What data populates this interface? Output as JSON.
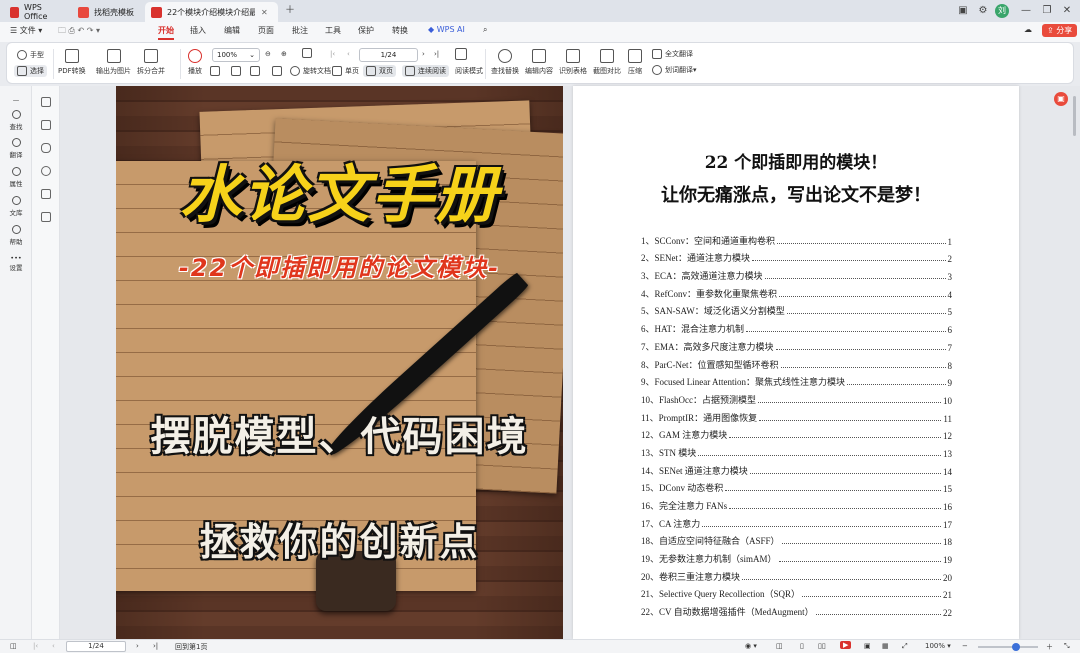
{
  "tabs": [
    {
      "label": "WPS Office",
      "color": "#d9322e"
    },
    {
      "label": "找稻壳模板",
      "color": "#e8483d"
    },
    {
      "label": "22个模块介绍模块介绍最新在...",
      "color": "#d9322e"
    }
  ],
  "menubar": {
    "file": "文件",
    "items": [
      "开始",
      "插入",
      "编辑",
      "页面",
      "批注",
      "工具",
      "保护",
      "转换"
    ],
    "active": "开始",
    "wps_ai": "WPS AI",
    "share": "分享"
  },
  "toolbar": {
    "hand": "手型",
    "select": "选择",
    "pdf_convert": "PDF转换",
    "export_image": "输出为图片",
    "split_merge": "拆分合并",
    "play": "播放",
    "zoom": "100%",
    "page": "1/24",
    "rotate": "旋转文档",
    "single": "单页",
    "double": "双页",
    "continuous": "连续阅读",
    "read_mode": "阅读模式",
    "find_replace": "查找替换",
    "edit_content": "编辑内容",
    "ocr_table": "识别表格",
    "screenshot_compare": "截图对比",
    "compress": "压缩",
    "full_translate": "全文翻译",
    "word_translate": "划词翻译"
  },
  "rail": [
    "查找",
    "翻译",
    "属性",
    "文库",
    "帮助",
    "设置"
  ],
  "cover": {
    "title": "水论文手册",
    "subtitle": "-22个即插即用的论文模块-",
    "line1": "摆脱模型、代码困境",
    "line2": "拯救你的创新点"
  },
  "toc": {
    "title1": "22 个即插即用的模块！",
    "title2": "让你无痛涨点，写出论文不是梦！",
    "items": [
      {
        "text": "1、SCConv：空间和通道重构卷积",
        "page": "1"
      },
      {
        "text": "2、SENet：通道注意力模块",
        "page": "2"
      },
      {
        "text": "3、ECA：高效通道注意力模块",
        "page": "3"
      },
      {
        "text": "4、RefConv：重参数化重聚焦卷积",
        "page": "4"
      },
      {
        "text": "5、SAN-SAW：域泛化语义分割模型",
        "page": "5"
      },
      {
        "text": "6、HAT：混合注意力机制",
        "page": "6"
      },
      {
        "text": "7、EMA：高效多尺度注意力模块",
        "page": "7"
      },
      {
        "text": "8、ParC-Net：位置感知型循环卷积",
        "page": "8"
      },
      {
        "text": "9、Focused Linear Attention：聚焦式线性注意力模块",
        "page": "9"
      },
      {
        "text": "10、FlashOcc：占据预测模型",
        "page": "10"
      },
      {
        "text": "11、PromptIR：通用图像恢复",
        "page": "11"
      },
      {
        "text": "12、GAM 注意力模块",
        "page": "12"
      },
      {
        "text": "13、STN 模块",
        "page": "13"
      },
      {
        "text": "14、SENet 通道注意力模块",
        "page": "14"
      },
      {
        "text": "15、DConv 动态卷积",
        "page": "15"
      },
      {
        "text": "16、完全注意力 FANs",
        "page": "16"
      },
      {
        "text": "17、CA 注意力",
        "page": "17"
      },
      {
        "text": "18、自适应空间特征融合（ASFF）",
        "page": "18"
      },
      {
        "text": "19、无参数注意力机制（simAM）",
        "page": "19"
      },
      {
        "text": "20、卷积三重注意力模块",
        "page": "20"
      },
      {
        "text": "21、Selective Query Recollection（SQR）",
        "page": "21"
      },
      {
        "text": "22、CV 自动数据增强插件（MedAugment）",
        "page": "22"
      }
    ]
  },
  "status": {
    "page": "1/24",
    "back": "回到第1页",
    "zoom": "100%"
  }
}
